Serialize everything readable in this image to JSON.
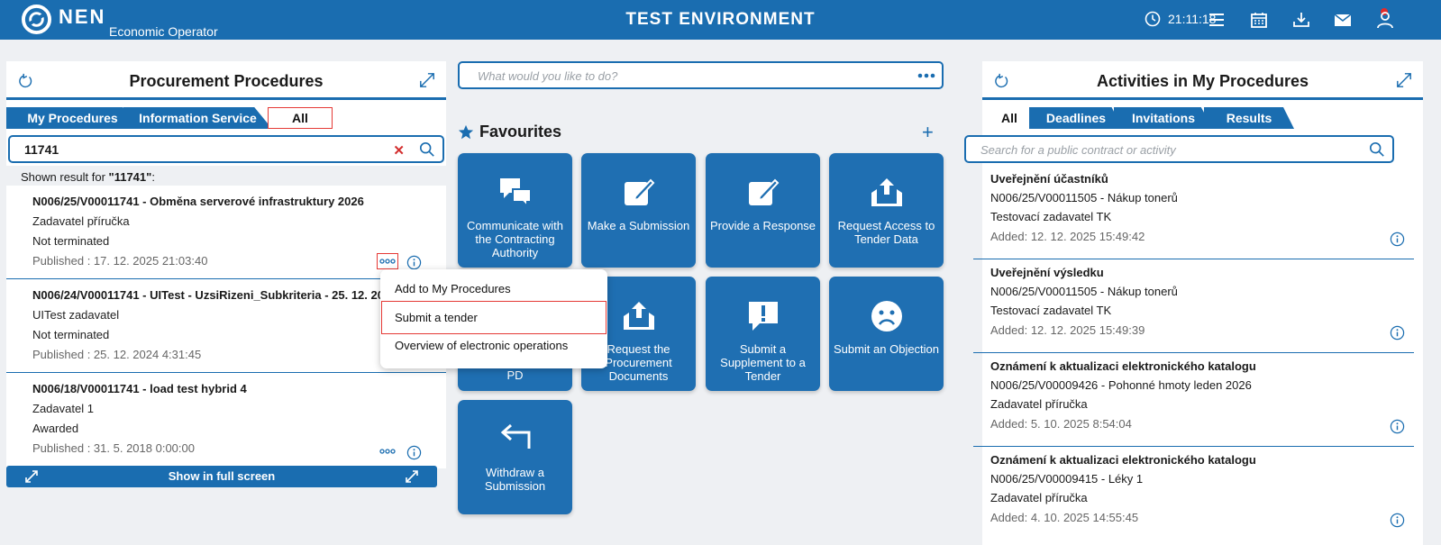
{
  "header": {
    "brand": "NEN",
    "subtitle": "Economic Operator",
    "environment": "TEST ENVIRONMENT",
    "time": "21:11:18",
    "icons": [
      "clock-icon",
      "menu-icon",
      "calendar-icon",
      "download-icon",
      "mail-icon",
      "user-icon"
    ],
    "accent": "#1a6db0",
    "notification_color": "#e32b2b"
  },
  "left": {
    "title": "Procurement Procedures",
    "tabs": [
      "My Procedures",
      "Information Service",
      "All"
    ],
    "search_value": "11741",
    "shown_prefix": "Shown result for ",
    "shown_query": "\"11741\"",
    "shown_suffix": ":",
    "results": [
      {
        "title": "N006/25/V00011741 - Obměna serverové infrastruktury 2026",
        "authority": "Zadavatel příručka",
        "status": "Not terminated",
        "published": "Published : 17. 12. 2025 21:03:40"
      },
      {
        "title": "N006/24/V00011741 - UITest - UzsiRizeni_Subkriteria - 25. 12. 2024",
        "authority": "UITest zadavatel",
        "status": "Not terminated",
        "published": "Published : 25. 12. 2024 4:31:45"
      },
      {
        "title": "N006/18/V00011741 - load test hybrid 4",
        "authority": "Zadavatel 1",
        "status": "Awarded",
        "published": "Published : 31. 5. 2018 0:00:00"
      }
    ],
    "fullscreen_label": "Show in full screen"
  },
  "context_menu": {
    "items": [
      "Add to My Procedures",
      "Submit a tender",
      "Overview of electronic operations"
    ]
  },
  "center": {
    "search_placeholder": "What would you like to do?",
    "favourites_title": "Favourites",
    "add_symbol": "+",
    "tiles": [
      {
        "label": "Communicate with the Contracting Authority",
        "icon": "chat-icon"
      },
      {
        "label": "Make a Submission",
        "icon": "edit-icon"
      },
      {
        "label": "Provide a Response",
        "icon": "edit-icon"
      },
      {
        "label": "Request Access to Tender Data",
        "icon": "upload-tray-icon"
      },
      {
        "label": "PD",
        "icon": "hidden"
      },
      {
        "label": "Request the Procurement Documents",
        "icon": "upload-tray-icon"
      },
      {
        "label": "Submit a Supplement to a Tender",
        "icon": "alert-bubble-icon"
      },
      {
        "label": "Submit an Objection",
        "icon": "sad-face-icon"
      },
      {
        "label": "Withdraw a Submission",
        "icon": "return-arrow-icon"
      }
    ]
  },
  "right": {
    "title": "Activities in My Procedures",
    "tabs": [
      "All",
      "Deadlines",
      "Invitations",
      "Results"
    ],
    "search_placeholder": "Search for a public contract or activity",
    "items": [
      {
        "title": "Uveřejnění účastníků",
        "contract": "N006/25/V00011505 - Nákup tonerů",
        "authority": "Testovací zadavatel TK",
        "added": "Added: 12. 12. 2025 15:49:42"
      },
      {
        "title": "Uveřejnění výsledku",
        "contract": "N006/25/V00011505 - Nákup tonerů",
        "authority": "Testovací zadavatel TK",
        "added": "Added: 12. 12. 2025 15:49:39"
      },
      {
        "title": "Oznámení k aktualizaci elektronického katalogu",
        "contract": "N006/25/V00009426 - Pohonné hmoty leden 2026",
        "authority": "Zadavatel příručka",
        "added": "Added: 5. 10. 2025 8:54:04"
      },
      {
        "title": "Oznámení k aktualizaci elektronického katalogu",
        "contract": "N006/25/V00009415 - Léky 1",
        "authority": "Zadavatel příručka",
        "added": "Added: 4. 10. 2025 14:55:45"
      }
    ]
  }
}
